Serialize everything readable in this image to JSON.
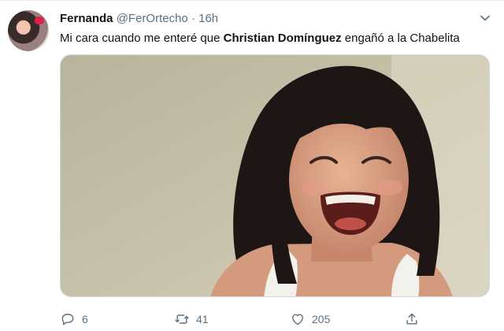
{
  "tweet": {
    "author_name": "Fernanda",
    "handle": "@FerOrtecho",
    "separator": "·",
    "time": "16h",
    "text_before": "Mi cara cuando me enteré que ",
    "text_bold": "Christian Domínguez",
    "text_after": " engañó a la Chabelita",
    "replies": "6",
    "retweets": "41",
    "likes": "205"
  },
  "icons": {
    "menu": "chevron-down-icon",
    "reply": "reply-icon",
    "retweet": "retweet-icon",
    "like": "heart-icon",
    "share": "share-icon"
  },
  "colors": {
    "meta_text": "#5b7083",
    "border": "#cfd9de"
  }
}
